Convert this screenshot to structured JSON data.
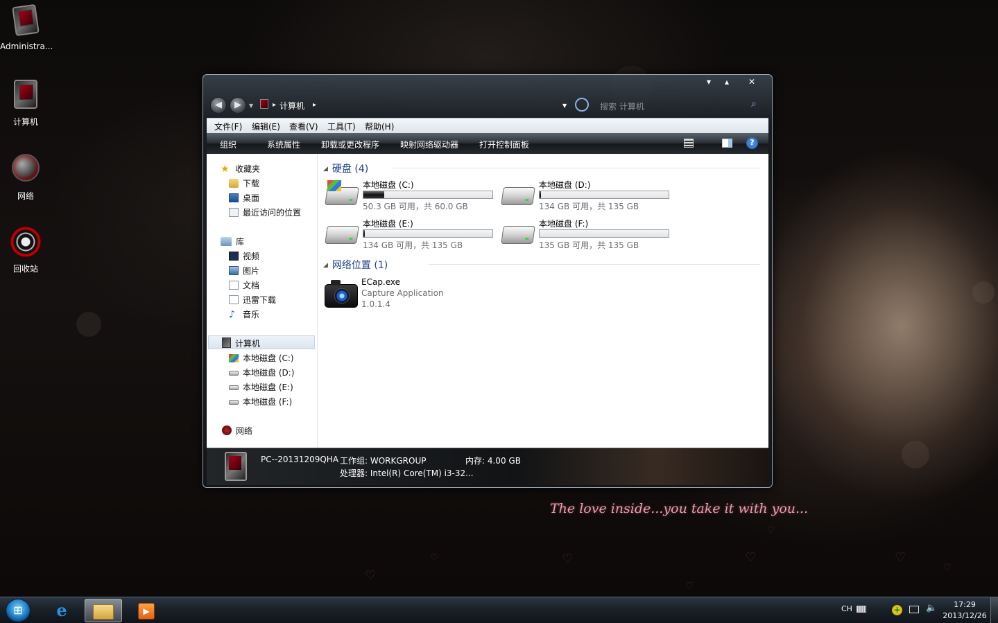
{
  "desktop": {
    "icons": [
      {
        "label": "Administra..."
      },
      {
        "label": "计算机"
      },
      {
        "label": "网络"
      },
      {
        "label": "回收站"
      }
    ],
    "tagline": "The love inside...you take it with you..."
  },
  "window": {
    "caption_buttons": {
      "minimize": "▾",
      "maximize": "▴",
      "close": "✕"
    },
    "address": {
      "crumb": "计算机",
      "separator": "▸"
    },
    "search": {
      "placeholder": "搜索 计算机"
    },
    "menubar": [
      "文件(F)",
      "编辑(E)",
      "查看(V)",
      "工具(T)",
      "帮助(H)"
    ],
    "toolbar": [
      "组织",
      "系统属性",
      "卸载或更改程序",
      "映射网络驱动器",
      "打开控制面板"
    ],
    "help_icon": "?",
    "nav": {
      "favorites": {
        "label": "收藏夹",
        "items": [
          "下载",
          "桌面",
          "最近访问的位置"
        ]
      },
      "libraries": {
        "label": "库",
        "items": [
          "视频",
          "图片",
          "文档",
          "迅雷下载",
          "音乐"
        ]
      },
      "computer": {
        "label": "计算机",
        "items": [
          "本地磁盘 (C:)",
          "本地磁盘 (D:)",
          "本地磁盘 (E:)",
          "本地磁盘 (F:)"
        ]
      },
      "network": {
        "label": "网络"
      }
    },
    "groups": {
      "drives": {
        "title": "硬盘 (4)"
      },
      "network": {
        "title": "网络位置 (1)"
      }
    },
    "drives": [
      {
        "name": "本地磁盘 (C:)",
        "free_text": "50.3 GB 可用，共 60.0 GB",
        "used_fraction": 0.16
      },
      {
        "name": "本地磁盘 (D:)",
        "free_text": "134 GB 可用，共 135 GB",
        "used_fraction": 0.01
      },
      {
        "name": "本地磁盘 (E:)",
        "free_text": "134 GB 可用，共 135 GB",
        "used_fraction": 0.01
      },
      {
        "name": "本地磁盘 (F:)",
        "free_text": "135 GB 可用，共 135 GB",
        "used_fraction": 0.0
      }
    ],
    "network_item": {
      "name": "ECap.exe",
      "description": "Capture Application",
      "version": "1.0.1.4"
    },
    "details": {
      "pc_name": "PC--20131209QHA",
      "workgroup": "工作组: WORKGROUP",
      "memory": "内存: 4.00 GB",
      "processor": "处理器: Intel(R) Core(TM) i3-32..."
    }
  },
  "taskbar": {
    "start_icon": "⊞",
    "media_icon": "▶",
    "tray": {
      "lang": "CH"
    },
    "clock": {
      "time": "17:29",
      "date": "2013/12/26"
    }
  },
  "colors": {
    "group_title": "#1e3f8c",
    "accent": "#1a78c2"
  }
}
